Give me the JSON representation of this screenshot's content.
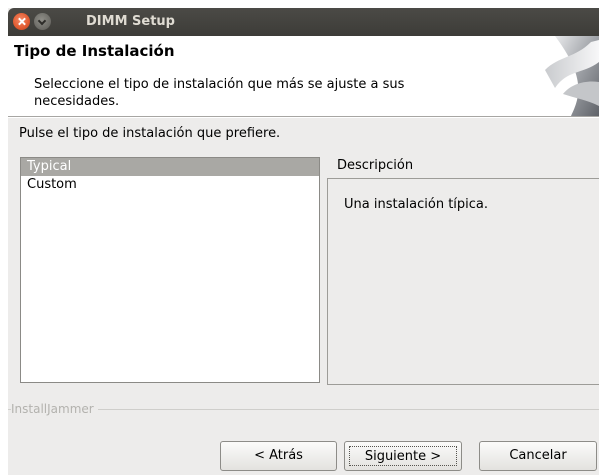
{
  "window": {
    "title": "DIMM Setup"
  },
  "header": {
    "title": "Tipo de Instalación",
    "description": "Seleccione el tipo de instalación que más se ajuste a sus necesidades."
  },
  "main": {
    "prompt": "Pulse el tipo de instalación que prefiere.",
    "install_types": [
      {
        "label": "Typical",
        "selected": true
      },
      {
        "label": "Custom",
        "selected": false
      }
    ],
    "description_label": "Descripción",
    "description_text": "Una instalación típica."
  },
  "footer": {
    "brand": "InstallJammer",
    "back_label": "< Atrás",
    "next_label": "Siguiente >",
    "cancel_label": "Cancelar"
  },
  "icons": {
    "close": "close-icon",
    "minimize": "minimize-icon",
    "header_art": "installer-graphic"
  },
  "colors": {
    "titlebar": "#3d3c38",
    "close_button": "#e05a30",
    "selection": "#a9a8a4",
    "window_bg": "#edeceb"
  }
}
